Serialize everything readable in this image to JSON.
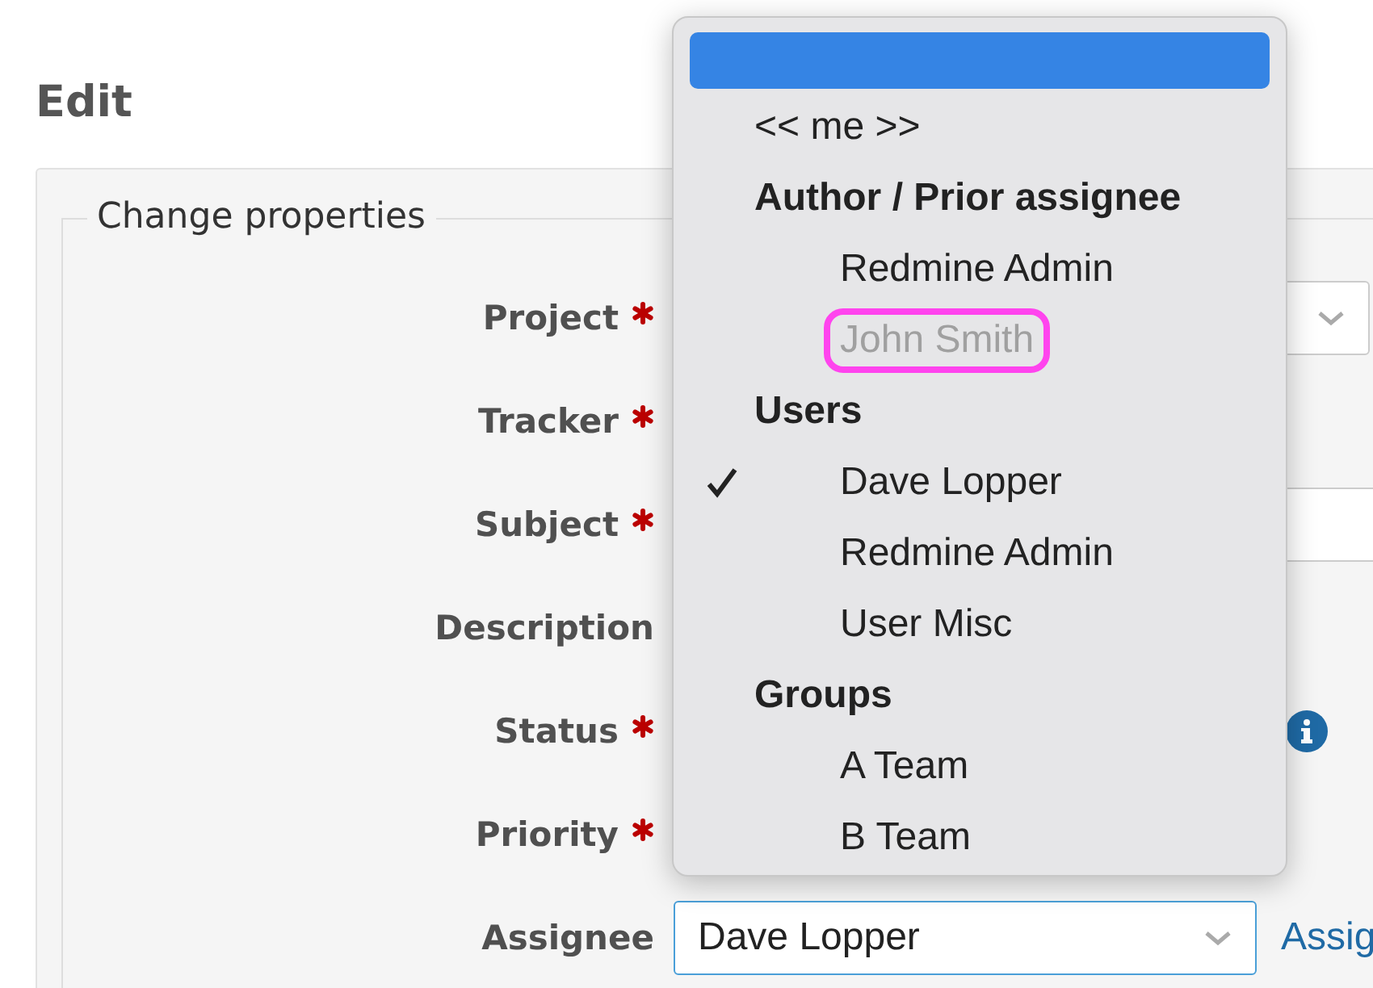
{
  "heading": "Edit",
  "fieldset": {
    "legend": "Change properties",
    "rows": [
      {
        "label": "Project",
        "required": true,
        "kind": "select"
      },
      {
        "label": "Tracker",
        "required": true,
        "kind": "hidden"
      },
      {
        "label": "Subject",
        "required": true,
        "kind": "input"
      },
      {
        "label": "Description",
        "required": false,
        "kind": "hidden"
      },
      {
        "label": "Status",
        "required": true,
        "kind": "hidden",
        "info": true
      },
      {
        "label": "Priority",
        "required": true,
        "kind": "hidden"
      },
      {
        "label": "Assignee",
        "required": false,
        "kind": "select",
        "value": "Dave Lopper",
        "link": "Assig"
      }
    ]
  },
  "dropdown": {
    "items": [
      {
        "kind": "option",
        "highlighted": true
      },
      {
        "kind": "option",
        "label": "<< me >>",
        "highlighted": false
      },
      {
        "kind": "group",
        "label": "Author / Prior assignee",
        "children": [
          {
            "label": "Redmine Admin",
            "selected": false,
            "disabled": false,
            "circled": false
          },
          {
            "label": "John Smith",
            "selected": false,
            "disabled": true,
            "circled": true
          }
        ]
      },
      {
        "kind": "group",
        "label": "Users",
        "children": [
          {
            "label": "Dave Lopper",
            "selected": true,
            "disabled": false,
            "circled": false
          },
          {
            "label": "Redmine Admin",
            "selected": false,
            "disabled": false,
            "circled": false
          },
          {
            "label": "User Misc",
            "selected": false,
            "disabled": false,
            "circled": false
          }
        ]
      },
      {
        "kind": "group",
        "label": "Groups",
        "children": [
          {
            "label": "A Team",
            "selected": false,
            "disabled": false,
            "circled": false
          },
          {
            "label": "B Team",
            "selected": false,
            "disabled": false,
            "circled": false
          }
        ]
      }
    ]
  }
}
